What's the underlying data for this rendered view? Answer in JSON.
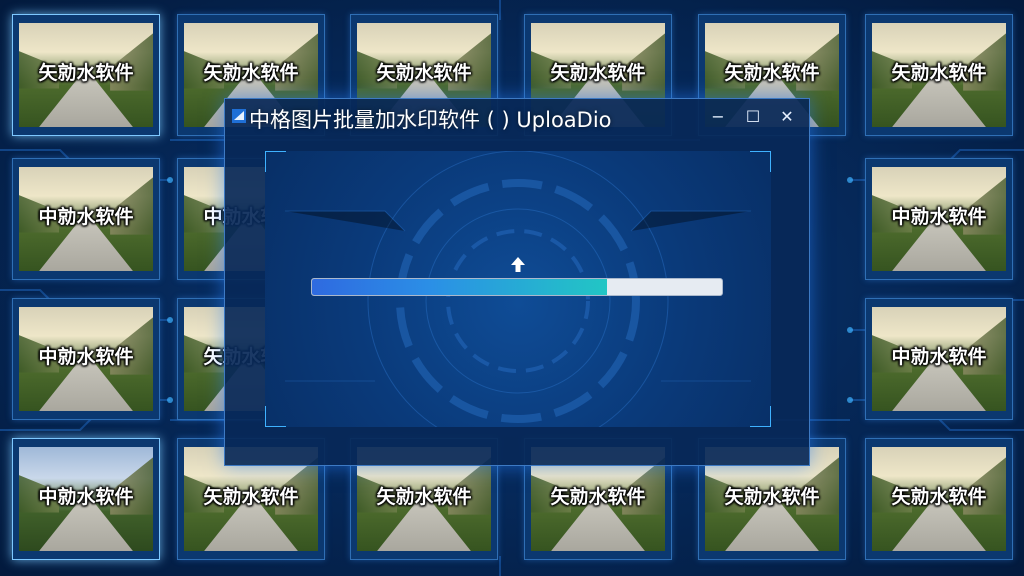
{
  "background": {
    "accent_color": "#3fb2ff",
    "base_color": "#062a5c"
  },
  "thumbnails": [
    {
      "watermark": "矢勍水软件"
    },
    {
      "watermark": "矢勍水软件"
    },
    {
      "watermark": "矢勍水软件"
    },
    {
      "watermark": "矢勍水软件"
    },
    {
      "watermark": "矢勍水软件"
    },
    {
      "watermark": "矢勍水软件"
    },
    {
      "watermark": "中勍水软件"
    },
    {
      "watermark": "中勍水软件"
    },
    {
      "watermark": "中勍水软件"
    },
    {
      "watermark": "中勍水软件"
    },
    {
      "watermark": "矢勍水软件"
    },
    {
      "watermark": "中勍水软件"
    },
    {
      "watermark": "中勍水软件"
    },
    {
      "watermark": "矢勍水软件"
    },
    {
      "watermark": "矢勍水软件"
    },
    {
      "watermark": "矢勍水软件"
    },
    {
      "watermark": "矢勍水软件"
    },
    {
      "watermark": "矢勍水软件"
    },
    {
      "watermark": "矢勍水软件"
    },
    {
      "watermark": "矢勍水软件"
    }
  ],
  "dialog": {
    "title": "中格图片批量加水印软件 ( ) UploaDio",
    "minimize_icon": "minimize-icon",
    "maximize_icon": "maximize-icon",
    "close_icon": "close-icon",
    "minimize_glyph": "−",
    "maximize_glyph": "☐",
    "close_glyph": "✕",
    "upload_icon": "upload-arrow-icon",
    "progress": 0.72,
    "progress_colors": [
      "#2f6ae0",
      "#22c6c4"
    ]
  }
}
